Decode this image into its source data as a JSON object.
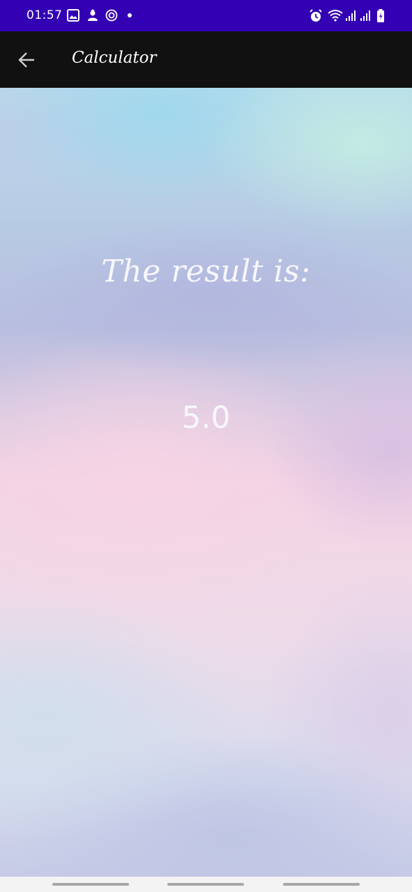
{
  "status_bar": {
    "time": "01:57",
    "background": "#3300b4",
    "left_icons": [
      "gallery-icon",
      "person-upload-icon",
      "sync-icon",
      "notification-dot-icon"
    ],
    "right_icons": [
      "alarm-icon",
      "wifi-icon",
      "signal-icon",
      "signal-icon",
      "battery-icon"
    ]
  },
  "app_bar": {
    "title": "Calculator",
    "back_icon": "arrow-left-icon",
    "background": "#111111"
  },
  "content": {
    "result_label": "The result is:",
    "result_value": "5.0"
  },
  "nav_bar": {
    "handles": [
      "recent-apps",
      "home",
      "back"
    ]
  }
}
